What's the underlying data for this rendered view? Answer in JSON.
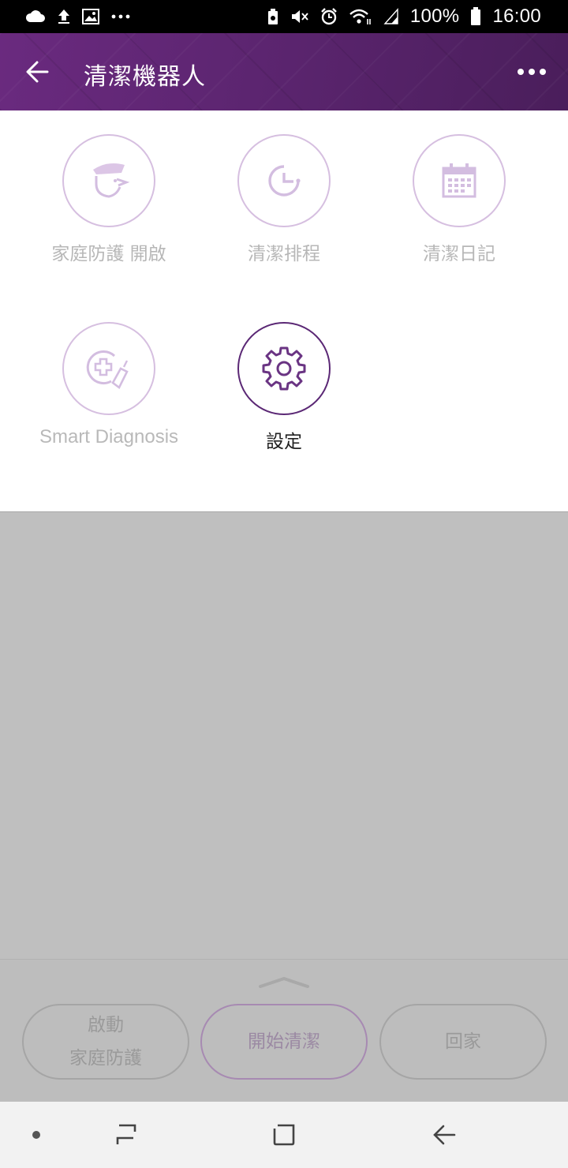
{
  "status_bar": {
    "battery_percent": "100%",
    "time": "16:00",
    "left_icons": [
      "cloud-icon",
      "upload-icon",
      "image-icon",
      "more-notifications-icon"
    ],
    "right_icons": [
      "recycle-icon",
      "mute-icon",
      "alarm-icon",
      "wifi-icon",
      "signal-icon",
      "battery-icon"
    ]
  },
  "app_bar": {
    "title": "清潔機器人",
    "back_icon": "arrow-left-icon",
    "more_icon": "more-horizontal-icon"
  },
  "menu": {
    "items": [
      {
        "label": "家庭防護 開啟",
        "icon": "guard-icon",
        "active": false
      },
      {
        "label": "清潔排程",
        "icon": "clock-icon",
        "active": false
      },
      {
        "label": "清潔日記",
        "icon": "calendar-icon",
        "active": false
      },
      {
        "label": "Smart Diagnosis",
        "icon": "diagnosis-icon",
        "active": false
      },
      {
        "label": "設定",
        "icon": "gear-icon",
        "active": true
      }
    ]
  },
  "bottom_sheet": {
    "handle_icon": "chevron-up-icon",
    "buttons": [
      {
        "line1": "啟動",
        "line2": "家庭防護"
      },
      {
        "line1": "開始清潔"
      },
      {
        "line1": "回家"
      }
    ]
  },
  "nav_bar": {
    "icons": [
      "dot-icon",
      "recent-apps-icon",
      "home-icon",
      "back-icon"
    ]
  },
  "colors": {
    "brand_purple": "#5c2570",
    "light_purple": "#d6bfe0",
    "overlay_gray": "#bfbfbf"
  }
}
